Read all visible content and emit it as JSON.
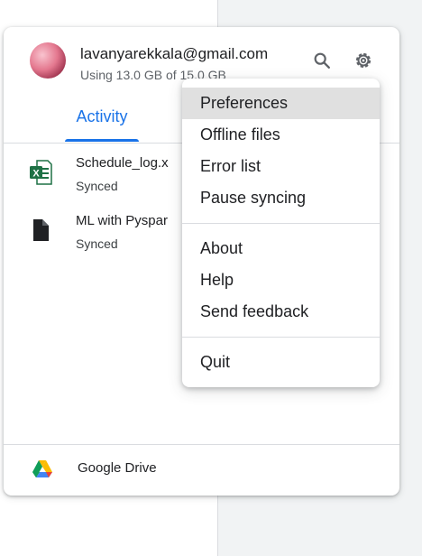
{
  "account": {
    "email": "lavanyarekkala@gmail.com",
    "storage": "Using 13.0 GB of 15.0 GB"
  },
  "icons": {
    "search": "search-icon",
    "settings": "gear-icon",
    "excel": "excel-file-icon",
    "document": "document-file-icon",
    "drive": "google-drive-icon"
  },
  "tabs": {
    "activity": "Activity"
  },
  "files": [
    {
      "name": "Schedule_log.x",
      "status": "Synced"
    },
    {
      "name": "ML with Pyspar",
      "status": "Synced"
    }
  ],
  "footer": {
    "label": "Google Drive"
  },
  "menu": {
    "items": [
      "Preferences",
      "Offline files",
      "Error list",
      "Pause syncing",
      "About",
      "Help",
      "Send feedback",
      "Quit"
    ],
    "highlighted": "Preferences"
  },
  "colors": {
    "accent": "#1a73e8",
    "highlight": "#e0e0e0",
    "excel_green": "#1e7145"
  }
}
